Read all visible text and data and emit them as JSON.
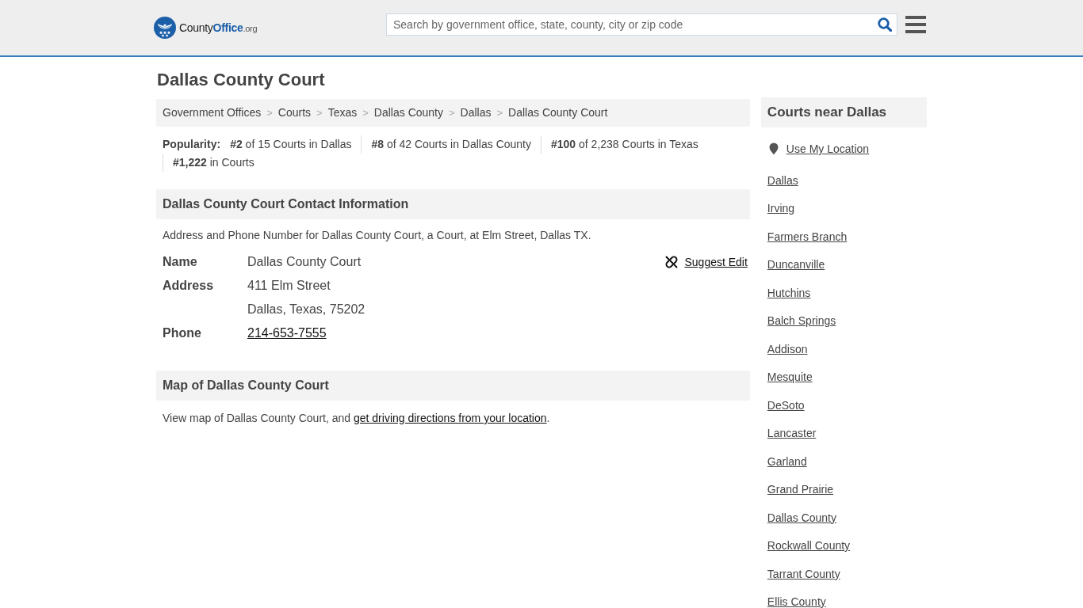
{
  "header": {
    "logo": {
      "parts": [
        "County",
        "Office",
        ".org"
      ]
    },
    "search": {
      "placeholder": "Search by government office, state, county, city or zip code"
    }
  },
  "page_title": "Dallas County Court",
  "breadcrumb": {
    "separator": ">",
    "items": [
      "Government Offices",
      "Courts",
      "Texas",
      "Dallas County",
      "Dallas",
      "Dallas County Court"
    ]
  },
  "popularity": {
    "label": "Popularity:",
    "ranks": [
      "**#2** of 15 Courts in Dallas",
      "**#8** of 42 Courts in Dallas County",
      "**#100** of 2,238 Courts in Texas",
      "**#1,222** in Courts"
    ]
  },
  "contact": {
    "heading": "Dallas County Court Contact Information",
    "description": "Address and Phone Number for Dallas County Court, a Court, at Elm Street, Dallas TX.",
    "suggest_edit": "Suggest Edit",
    "rows": [
      {
        "label": "Name",
        "kind": "text",
        "values": [
          "Dallas County Court"
        ]
      },
      {
        "label": "Address",
        "kind": "text",
        "values": [
          "411 Elm Street",
          "Dallas, Texas, 75202"
        ]
      },
      {
        "label": "Phone",
        "kind": "link",
        "values": [
          "214-653-7555"
        ]
      }
    ]
  },
  "map": {
    "heading": "Map of Dallas County Court",
    "text_before": "View map of Dallas County Court, and ",
    "link": "get driving directions from your location",
    "text_after": "."
  },
  "sidebar": {
    "heading": "Courts near Dallas",
    "use_location": "Use My Location",
    "links": [
      "Dallas",
      "Irving",
      "Farmers Branch",
      "Duncanville",
      "Hutchins",
      "Balch Springs",
      "Addison",
      "Mesquite",
      "DeSoto",
      "Lancaster",
      "Garland",
      "Grand Prairie",
      "Dallas County",
      "Rockwall County",
      "Tarrant County",
      "Ellis County"
    ]
  }
}
